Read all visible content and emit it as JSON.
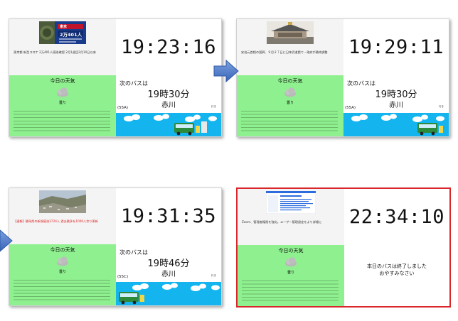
{
  "panels": [
    {
      "clock": "19:23:16",
      "thumb_badge": {
        "place": "東京",
        "count": "2万401人"
      },
      "headline": "東京都 新型コロナ 2万401人感染確認 2月1週目2月10日以来",
      "weather_title": "今日の天気",
      "weather_label": "曇り",
      "bus_label": "次のバスは",
      "bus_time": "19時30分",
      "bus_dest": "赤川",
      "bus_code": "(55A)",
      "bus_small": "行き"
    },
    {
      "clock": "19:29:11",
      "headline": "安倍元首相の国葬、９月２７日に日本武道館で・政府が最終調整",
      "weather_title": "今日の天気",
      "weather_label": "曇り",
      "bus_label": "次のバスは",
      "bus_time": "19時30分",
      "bus_dest": "赤川",
      "bus_code": "(55A)",
      "bus_small": "行き"
    },
    {
      "clock": "19:31:35",
      "headline": "【速報】静岡県の新規感染3724人 過去最多を1000人余り更新",
      "weather_title": "今日の天気",
      "weather_label": "曇り",
      "bus_label": "次のバスは",
      "bus_time": "19時46分",
      "bus_dest": "赤川",
      "bus_code": "(55C)",
      "bus_small": "行き"
    },
    {
      "clock": "22:34:10",
      "headline": "Zoom、管理者権限を強化。ユーザー管理設定をより詳細に",
      "weather_title": "今日の天気",
      "weather_label": "曇り",
      "bus_end_line1": "本日のバスは終了しました",
      "bus_end_line2": "おやすみなさい"
    }
  ],
  "colors": {
    "weather_bg": "#8ef08e",
    "sky_bg": "#14b4ee",
    "highlight_border": "#d8262b",
    "arrow": "#4a78c8"
  }
}
